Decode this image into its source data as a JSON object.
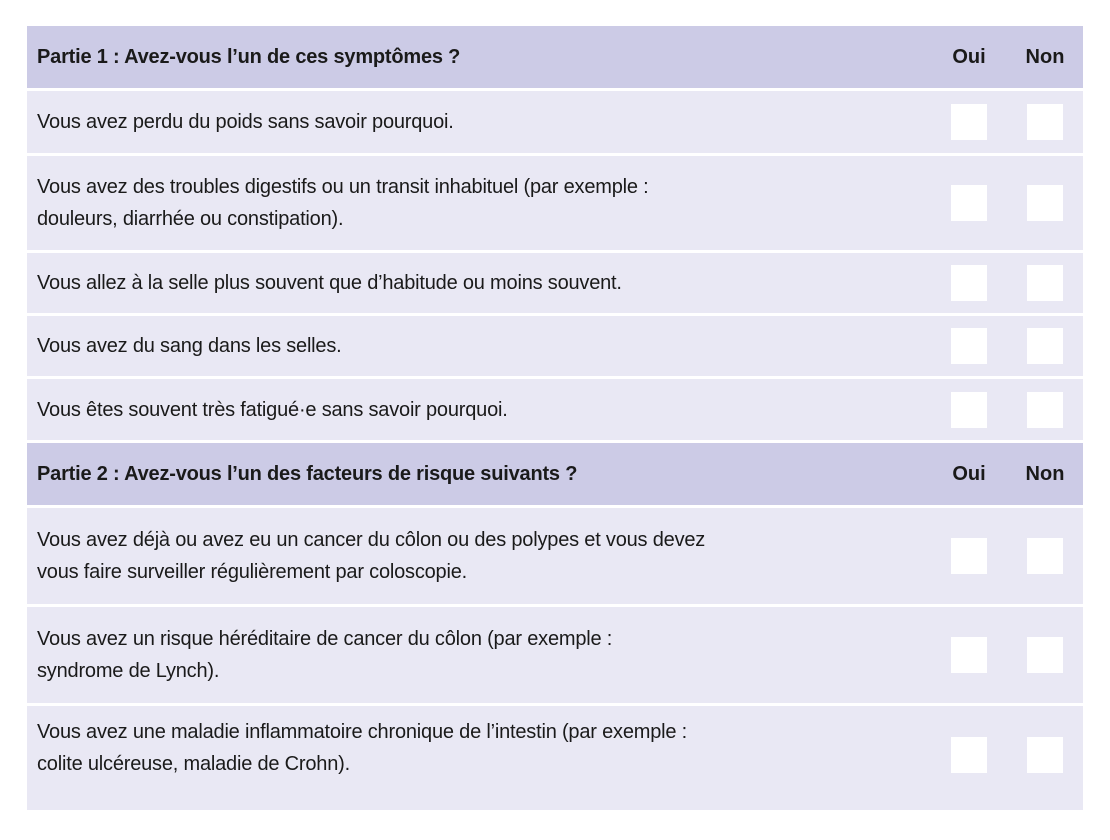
{
  "colors": {
    "header_bg": "#cccbe6",
    "row_bg": "#e9e8f4",
    "checkbox_bg": "#ffffff"
  },
  "sections": [
    {
      "title": "Partie 1 : Avez-vous l’un de ces symptômes ?",
      "col_yes": "Oui",
      "col_no": "Non",
      "items": [
        {
          "text": "Vous avez perdu du poids sans savoir pourquoi.",
          "yes_checked": false,
          "no_checked": false
        },
        {
          "text": "Vous avez des troubles digestifs ou un transit inhabituel (par exemple : douleurs, diarrhée ou constipation).",
          "line1": "Vous avez des troubles digestifs ou un transit inhabituel (par exemple :",
          "line2": "douleurs, diarrhée ou constipation).",
          "yes_checked": false,
          "no_checked": false
        },
        {
          "text": "Vous allez à la selle plus souvent que d’habitude ou moins souvent.",
          "yes_checked": false,
          "no_checked": false
        },
        {
          "text": "Vous avez du sang dans les selles.",
          "yes_checked": false,
          "no_checked": false
        },
        {
          "text": "Vous êtes souvent très fatigué·e sans savoir pourquoi.",
          "yes_checked": false,
          "no_checked": false
        }
      ]
    },
    {
      "title": "Partie 2 : Avez-vous l’un des facteurs de risque suivants ?",
      "col_yes": "Oui",
      "col_no": "Non",
      "items": [
        {
          "line1": "Vous avez déjà ou avez eu un cancer du côlon ou des polypes et vous devez",
          "line2": "vous faire surveiller régulièrement par coloscopie.",
          "yes_checked": false,
          "no_checked": false
        },
        {
          "line1": "Vous avez un risque héréditaire de cancer du côlon (par exemple :",
          "line2": "syndrome de Lynch).",
          "yes_checked": false,
          "no_checked": false
        },
        {
          "line1": "Vous avez une maladie inflammatoire chronique de l’intestin (par exemple :",
          "line2": "colite ulcéreuse, maladie de Crohn).",
          "yes_checked": false,
          "no_checked": false
        }
      ]
    }
  ]
}
